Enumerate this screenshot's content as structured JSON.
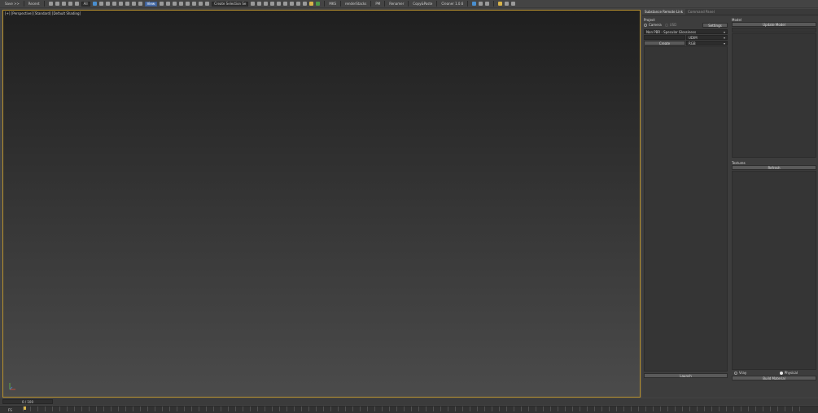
{
  "toolbar": {
    "save": "Save >>",
    "recent": "Recent",
    "all_filter": "All",
    "view_dropdown": "View",
    "selection_set": "Create Selection Se",
    "buttons": [
      "MKS",
      "renderStacks",
      "PM",
      "Renamer",
      "Copy&Paste",
      "Cleaner 1.0.6"
    ]
  },
  "viewport": {
    "label": "[+] [Perspective] [Standard] [Default Shading]"
  },
  "panel": {
    "tabs": [
      "Substance Remote Link",
      "Command Panel"
    ],
    "project": {
      "title": "Project",
      "radio_camera": "Camera",
      "radio_usd": "USD",
      "settings_btn": "Settings",
      "workflow": "Non PBR - Specular Glossiness",
      "resolution": "UDIM",
      "create_btn": "Create",
      "mode": "RGB",
      "launch_btn": "Launch"
    },
    "model": {
      "title": "Model",
      "update_btn": "Update Model"
    },
    "textures": {
      "title": "Textures",
      "refresh_btn": "Refresh",
      "radio_vray": "Vray",
      "radio_physical": "Physical",
      "build_btn": "Build Material"
    }
  },
  "timeline": {
    "range": "0 / 100",
    "frame_label": "FS"
  }
}
